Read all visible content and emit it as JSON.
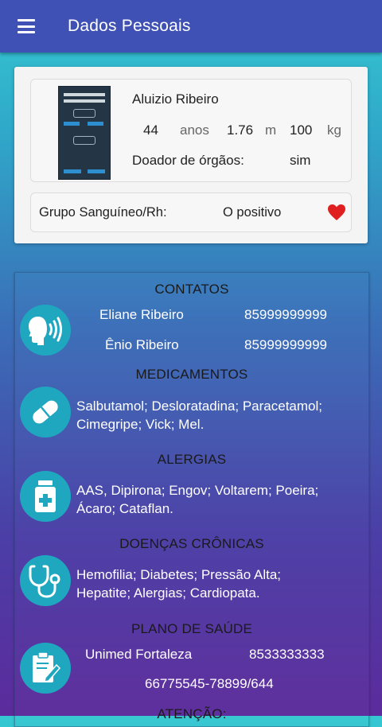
{
  "header": {
    "title": "Dados Pessoais",
    "menu_icon": "hamburger-menu-icon"
  },
  "profile": {
    "name": "Aluizio Ribeiro",
    "age": "44",
    "age_unit": "anos",
    "height": "1.76",
    "height_unit": "m",
    "weight": "100",
    "weight_unit": "kg",
    "donor_label": "Doador de órgãos:",
    "donor_value": "sim",
    "blood_label": "Grupo Sanguíneo/Rh:",
    "blood_value": "O positivo",
    "heart_icon": "heart-icon",
    "heart_color": "#e02020"
  },
  "sections": {
    "contacts": {
      "title": "CONTATOS",
      "icon": "speaking-head-icon",
      "items": [
        {
          "name": "Eliane Ribeiro",
          "phone": "85999999999"
        },
        {
          "name": "Ênio Ribeiro",
          "phone": "85999999999"
        }
      ]
    },
    "medications": {
      "title": "MEDICAMENTOS",
      "icon": "pill-icon",
      "line1": "Salbutamol; Desloratadina; Paracetamol;",
      "line2": "Cimegripe; Vick; Mel."
    },
    "allergies": {
      "title": "ALERGIAS",
      "icon": "medicine-bottle-icon",
      "line1": "AAS, Dipirona; Engov; Voltarem; Poeira;",
      "line2": "Ácaro; Cataflan."
    },
    "chronic": {
      "title": "DOENÇAS CRÔNICAS",
      "icon": "stethoscope-icon",
      "line1": "Hemofilia; Diabetes; Pressão Alta;",
      "line2": "Hepatite; Alergias; Cardiopata."
    },
    "health_plan": {
      "title": "PLANO DE SAÚDE",
      "icon": "clipboard-edit-icon",
      "provider": "Unimed Fortaleza",
      "phone": "8533333333",
      "card_number": "66775545-78899/644"
    },
    "attention": {
      "title": "ATENÇÃO:"
    }
  },
  "colors": {
    "appbar": "#3f51b5",
    "icon_circle": "#1fa7bf"
  }
}
